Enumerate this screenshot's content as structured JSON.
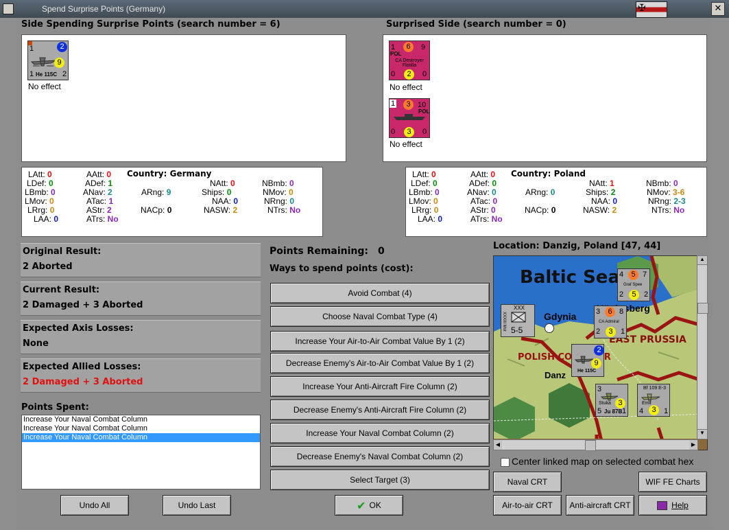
{
  "window": {
    "title": "Spend Surprise Points (Germany)",
    "close_glyph": "✕"
  },
  "left_side": {
    "header": "Side Spending Surprise Points (search number = 6)",
    "units": [
      {
        "name": "He 115C",
        "tl": "1",
        "badge": "2",
        "center": "9",
        "bl": "1",
        "br": "2",
        "caption": "No effect"
      }
    ],
    "country_label": "Country: Germany",
    "stats": {
      "LAtt": "0",
      "LDef": "0",
      "LBmb": "0",
      "LMov": "0",
      "LRrg": "0",
      "LAA": "0",
      "AAtt": "0",
      "ADef": "1",
      "ANav": "2",
      "ATac": "1",
      "AStr": "2",
      "ATrs": "No",
      "ARng": "9",
      "NACp": "0",
      "NAtt": "0",
      "Ships": "0",
      "NAA": "0",
      "NASW": "2",
      "NBmb": "0",
      "NMov": "0",
      "NRng": "0",
      "NTrs": "No"
    }
  },
  "right_side": {
    "header": "Surprised Side (search number = 0)",
    "units": [
      {
        "name": "CA Destroyer Flotilla",
        "nation": "POL",
        "tl": "1",
        "oval": "6",
        "tr": "9",
        "bl": "0",
        "center": "2",
        "br": "0",
        "caption": "No effect"
      },
      {
        "name": "",
        "nation": "POL",
        "tl": "1",
        "oval": "3",
        "tr": "10",
        "bl": "0",
        "center": "3",
        "br": "0",
        "caption": "No effect"
      }
    ],
    "country_label": "Country: Poland",
    "stats": {
      "LAtt": "0",
      "LDef": "0",
      "LBmb": "0",
      "LMov": "0",
      "LRrg": "0",
      "LAA": "0",
      "AAtt": "0",
      "ADef": "0",
      "ANav": "0",
      "ATac": "0",
      "AStr": "0",
      "ATrs": "No",
      "ARng": "0",
      "NACp": "0",
      "NAtt": "1",
      "Ships": "2",
      "NAA": "0",
      "NASW": "2",
      "NBmb": "0",
      "NMov": "3-6",
      "NRng": "2-3",
      "NTrs": "No"
    }
  },
  "results": [
    {
      "title": "Original Result:",
      "value": "2 Aborted"
    },
    {
      "title": "Current Result:",
      "value": "2 Damaged + 3 Aborted"
    },
    {
      "title": "Expected Axis Losses:",
      "value": "None"
    },
    {
      "title": "Expected Allied Losses:",
      "value": "2 Damaged + 3 Aborted"
    }
  ],
  "points_spent": {
    "label": "Points Spent:",
    "items": [
      "Increase Your Naval Combat Column",
      "Increase Your Naval Combat Column",
      "Increase Your Naval Combat Column"
    ]
  },
  "points_remaining": {
    "label": "Points Remaining:",
    "value": "0"
  },
  "ways_label": "Ways to spend points (cost):",
  "spend_options": [
    "Avoid Combat (4)",
    "Choose Naval Combat Type (4)",
    "Increase Your Air-to-Air Combat Value By 1 (2)",
    "Decrease Enemy's Air-to-Air Combat Value By 1 (2)",
    "Increase Your Anti-Aircraft Fire Column (2)",
    "Decrease Enemy's Anti-Aircraft Fire Column (2)",
    "Increase Your Naval Combat Column (2)",
    "Decrease Enemy's Naval Combat Column (2)",
    "Select Target (3)"
  ],
  "buttons": {
    "undo_all": "Undo All",
    "undo_last": "Undo Last",
    "ok": "OK",
    "naval_crt": "Naval CRT",
    "wif_charts": "WIF FE Charts",
    "air_crt": "Air-to-air CRT",
    "aa_crt": "Anti-aircraft CRT",
    "help": "Help"
  },
  "map": {
    "location": "Location: Danzig, Poland [47, 44]",
    "labels": {
      "sea": "Baltic Sea",
      "gdynia": "Gdynia",
      "konigsberg": "Königsberg",
      "east_prussia": "EAST PRUSSIA",
      "corridor": "POLISH CORRIDOR",
      "danzig": "Danz"
    },
    "center_checkbox": "Center linked map on selected combat hex",
    "counters": {
      "army": {
        "top": "XXX",
        "side": "XXXIII Mot",
        "value": "5-5"
      },
      "he115": {
        "badge": "2",
        "center": "9",
        "name": "He 115C"
      },
      "stuka": {
        "name": "Stuka",
        "model": "Ju 87B",
        "tl": "3",
        "center": "3",
        "bl": "5",
        "br": "1"
      },
      "bf109": {
        "name": "Bf 109 E-3",
        "pilot": "Emil",
        "center": "3",
        "bl": "4",
        "br": "1"
      },
      "grafspee": {
        "name": "Graf Spee",
        "tl": "4",
        "oval": "5",
        "tr": "7",
        "bl": "2",
        "center": "5",
        "br": "2"
      },
      "ca_admiral": {
        "name": "CA Admiral",
        "tl": "3",
        "oval": "6",
        "tr": "8",
        "bl": "2",
        "center": "3",
        "br": "1"
      }
    }
  },
  "colors": {
    "result_value_red": "#e01010",
    "selection": "#3399ff",
    "sea": "#2a6fc9",
    "land": "#b8c878",
    "border_red": "#9a1414"
  }
}
